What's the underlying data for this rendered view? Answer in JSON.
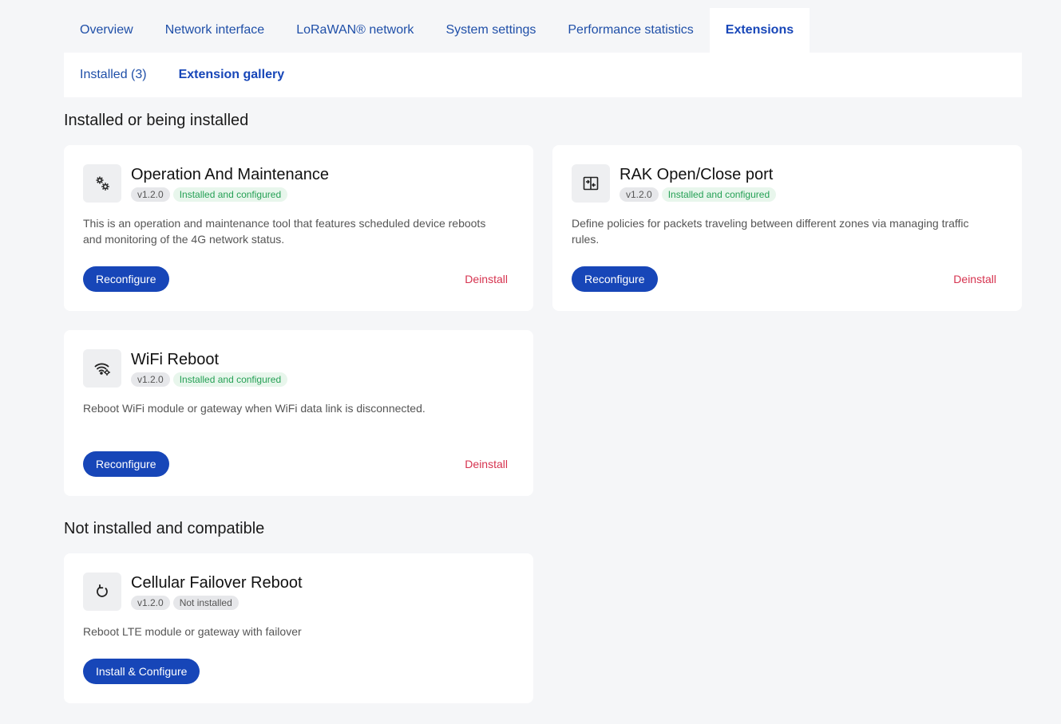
{
  "tabs": [
    {
      "label": "Overview"
    },
    {
      "label": "Network interface"
    },
    {
      "label": "LoRaWAN® network"
    },
    {
      "label": "System settings"
    },
    {
      "label": "Performance statistics"
    },
    {
      "label": "Extensions"
    }
  ],
  "subtabs": [
    {
      "label": "Installed (3)"
    },
    {
      "label": "Extension gallery"
    }
  ],
  "sections": {
    "installed_title": "Installed or being installed",
    "compatible_title": "Not installed and compatible"
  },
  "installed": [
    {
      "icon": "gears-icon",
      "title": "Operation And Maintenance",
      "version": "v1.2.0",
      "status": "Installed and configured",
      "description": "This is an operation and maintenance tool that features scheduled device reboots and monitoring of the 4G network status.",
      "primary_label": "Reconfigure",
      "secondary_label": "Deinstall"
    },
    {
      "icon": "port-icon",
      "title": "RAK Open/Close port",
      "version": "v1.2.0",
      "status": "Installed and configured",
      "description": "Define policies for packets traveling between different zones via managing traffic rules.",
      "primary_label": "Reconfigure",
      "secondary_label": "Deinstall"
    },
    {
      "icon": "wifi-gear-icon",
      "title": "WiFi Reboot",
      "version": "v1.2.0",
      "status": "Installed and configured",
      "description": "Reboot WiFi module or gateway when WiFi data link is disconnected.",
      "primary_label": "Reconfigure",
      "secondary_label": "Deinstall"
    }
  ],
  "compatible": [
    {
      "icon": "refresh-icon",
      "title": "Cellular Failover Reboot",
      "version": "v1.2.0",
      "status": "Not installed",
      "description": "Reboot LTE module or gateway with failover",
      "primary_label": "Install & Configure"
    }
  ],
  "colors": {
    "accent": "#1746b8",
    "danger": "#d6334f",
    "success": "#25a055",
    "background": "#f5f6f8"
  }
}
